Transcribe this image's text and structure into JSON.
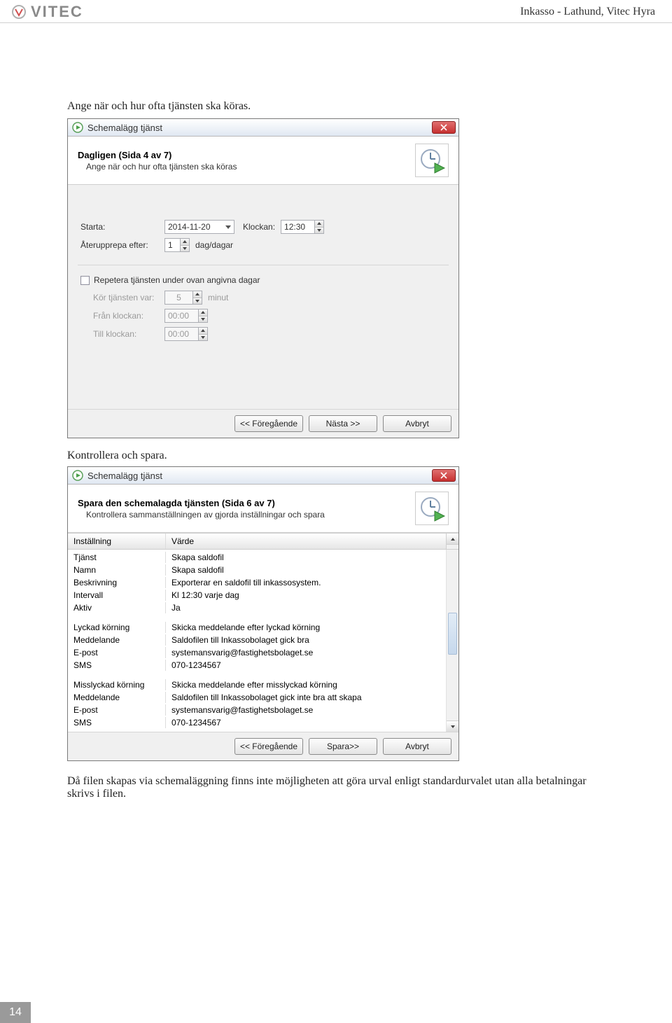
{
  "header": {
    "logo_text": "VITEC",
    "right": "Inkasso - Lathund, Vitec Hyra"
  },
  "intro": "Ange när och hur ofta tjänsten ska köras.",
  "dialog1": {
    "title": "Schemalägg tjänst",
    "heading": "Dagligen (Sida 4 av 7)",
    "subheading": "Ange när och hur ofta tjänsten ska köras",
    "labels": {
      "starta": "Starta:",
      "klockan": "Klockan:",
      "aterupprepa": "Återupprepa efter:",
      "dagdagar": "dag/dagar",
      "repetera": "Repetera tjänsten under ovan angivna dagar",
      "kor_tj": "Kör tjänsten var:",
      "minut": "minut",
      "fran": "Från klockan:",
      "till": "Till klockan:"
    },
    "values": {
      "date": "2014-11-20",
      "time": "12:30",
      "repeat_after": "1",
      "repeat_minutes": "5",
      "from_time": "00:00",
      "to_time": "00:00"
    },
    "buttons": {
      "prev": "<< Föregående",
      "next": "Nästa >>",
      "cancel": "Avbryt"
    }
  },
  "caption2": "Kontrollera och spara.",
  "dialog2": {
    "title": "Schemalägg tjänst",
    "heading": "Spara den schemalagda tjänsten  (Sida 6 av 7)",
    "subheading": "Kontrollera sammanställningen av gjorda inställningar och spara",
    "columns": {
      "a": "Inställning",
      "b": "Värde"
    },
    "rows": [
      {
        "a": "Tjänst",
        "b": "Skapa saldofil"
      },
      {
        "a": "Namn",
        "b": "Skapa saldofil"
      },
      {
        "a": "Beskrivning",
        "b": "Exporterar en saldofil till inkassosystem."
      },
      {
        "a": "Intervall",
        "b": "Kl 12:30 varje dag"
      },
      {
        "a": "Aktiv",
        "b": "Ja"
      }
    ],
    "rows_success": [
      {
        "a": "Lyckad körning",
        "b": "Skicka meddelande efter lyckad körning"
      },
      {
        "a": "Meddelande",
        "b": "Saldofilen till Inkassobolaget gick bra"
      },
      {
        "a": "E-post",
        "b": "systemansvarig@fastighetsbolaget.se"
      },
      {
        "a": "SMS",
        "b": "070-1234567"
      }
    ],
    "rows_fail": [
      {
        "a": "Misslyckad körning",
        "b": "Skicka meddelande efter misslyckad körning"
      },
      {
        "a": "Meddelande",
        "b": "Saldofilen till Inkassobolaget gick inte bra att skapa"
      },
      {
        "a": "E-post",
        "b": "systemansvarig@fastighetsbolaget.se"
      },
      {
        "a": "SMS",
        "b": "070-1234567"
      }
    ],
    "buttons": {
      "prev": "<< Föregående",
      "save": "Spara>>",
      "cancel": "Avbryt"
    }
  },
  "outro": "Då filen skapas via schemaläggning finns inte möjligheten att göra urval enligt standardurvalet utan alla betalningar skrivs i filen.",
  "page_number": "14"
}
